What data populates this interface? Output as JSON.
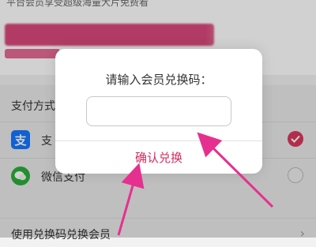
{
  "top_banner_text": "平台会员享受超级海量大片免费看",
  "payment": {
    "section_title": "支付方式",
    "methods": [
      {
        "label": "支",
        "icon": "alipay-icon",
        "selected": true
      },
      {
        "label": "微信支付",
        "icon": "wechat-pay-icon",
        "selected": false
      }
    ]
  },
  "redeem_row_label": "使用兑换码兑换会员",
  "dialog": {
    "title": "请输入会员兑换码：",
    "input_value": "",
    "confirm_label": "确认兑换"
  },
  "colors": {
    "accent": "#d12b5f",
    "alipay": "#1677ff",
    "wechat": "#2aae3b",
    "arrow": "#e6308f"
  }
}
